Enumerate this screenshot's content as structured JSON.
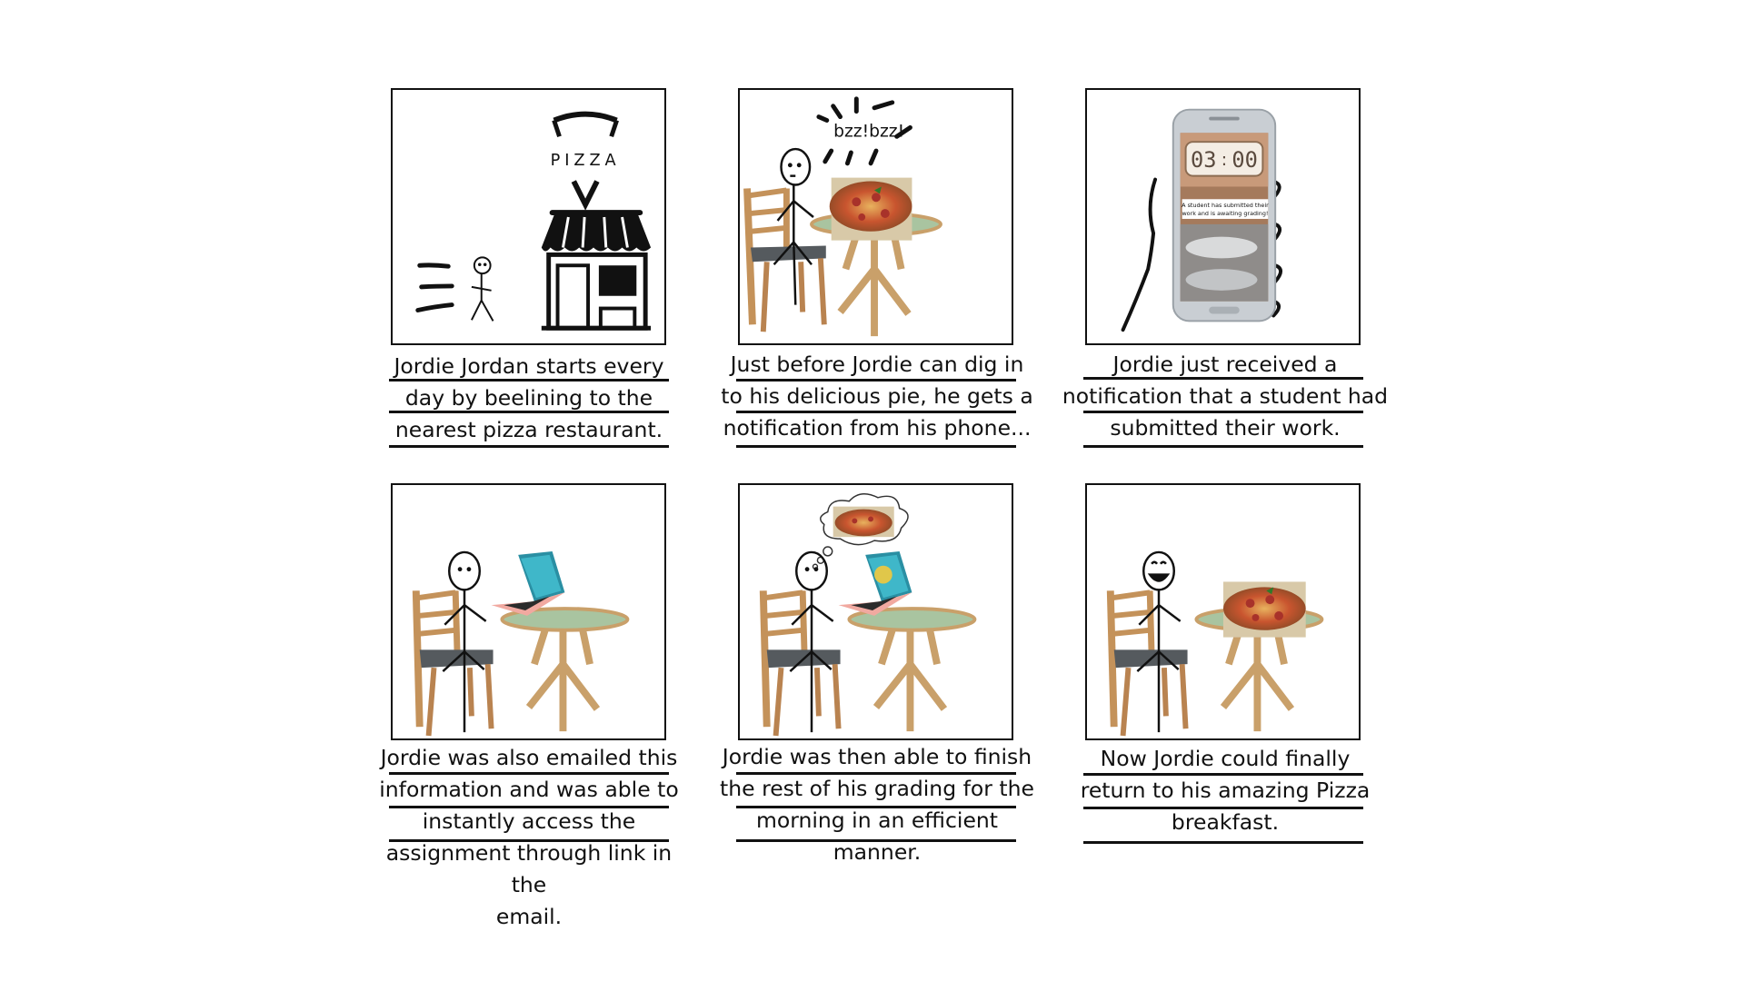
{
  "panels": [
    {
      "caption": [
        "Jordie Jordan starts every",
        "day by beelining to the",
        "nearest pizza restaurant."
      ],
      "sign_text": "PIZZA"
    },
    {
      "caption": [
        "Just before Jordie can dig in",
        "to his delicious pie, he gets a",
        "notification from his phone..."
      ],
      "sound_text": "bzz!bzz!"
    },
    {
      "caption": [
        "Jordie just received a",
        "notification that a student had",
        "submitted their work."
      ],
      "phone": {
        "timer_minutes": "03",
        "timer_seconds": "00",
        "notification_line1": "A student has submitted their",
        "notification_line2": "work and is awaiting grading!"
      }
    },
    {
      "caption": [
        "Jordie was also emailed this",
        "information and was able to",
        "instantly access the",
        "assignment through link in the",
        "email."
      ]
    },
    {
      "caption": [
        "Jordie was then able to finish",
        "the rest of his grading for the",
        "morning in an efficient",
        "manner."
      ]
    },
    {
      "caption": [
        "Now Jordie could finally",
        "return to his amazing Pizza",
        "breakfast."
      ]
    }
  ],
  "colors": {
    "ink": "#111111",
    "table_top": "#a9c4a0",
    "table_wood": "#c9a06a",
    "chair_wood": "#d1a36a",
    "chair_seat": "#555a5e",
    "laptop_shell": "#f1a9a0",
    "laptop_screen": "#3fb7c9",
    "phone_body": "#c9ced3",
    "pizza_crust": "#d79a4e",
    "pizza_sauce": "#c2432a"
  },
  "icons": [
    "stick-figure-icon",
    "pizza-shop-icon",
    "chair-icon",
    "table-icon",
    "pizza-photo-icon",
    "smartphone-icon",
    "laptop-icon",
    "thought-bubble-icon"
  ]
}
